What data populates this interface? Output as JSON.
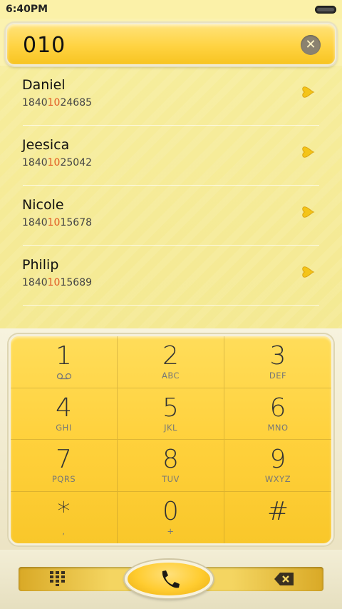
{
  "status_bar": {
    "time": "6:40PM"
  },
  "search": {
    "query": "010",
    "clear_icon": "close-icon"
  },
  "contacts": [
    {
      "name": "Daniel",
      "number_pre": "1840",
      "number_match": "10",
      "number_post": "24685"
    },
    {
      "name": "Jeesica",
      "number_pre": "1840",
      "number_match": "10",
      "number_post": "25042"
    },
    {
      "name": "Nicole",
      "number_pre": "1840",
      "number_match": "10",
      "number_post": "15678"
    },
    {
      "name": "Philip",
      "number_pre": "1840",
      "number_match": "10",
      "number_post": "15689"
    }
  ],
  "dialpad": {
    "keys": [
      {
        "digit": "1",
        "letters": ""
      },
      {
        "digit": "2",
        "letters": "ABC"
      },
      {
        "digit": "3",
        "letters": "DEF"
      },
      {
        "digit": "4",
        "letters": "GHI"
      },
      {
        "digit": "5",
        "letters": "JKL"
      },
      {
        "digit": "6",
        "letters": "MNO"
      },
      {
        "digit": "7",
        "letters": "PQRS"
      },
      {
        "digit": "8",
        "letters": "TUV"
      },
      {
        "digit": "9",
        "letters": "WXYZ"
      },
      {
        "digit": "*",
        "letters": ","
      },
      {
        "digit": "0",
        "letters": "+"
      },
      {
        "digit": "#",
        "letters": ""
      }
    ]
  },
  "colors": {
    "accent": "#ffd342",
    "match_highlight": "#e15a22",
    "background": "#f3ea9c"
  },
  "icons": {
    "contact_action": "heart-icon",
    "keypad_toggle": "keypad-grid-icon",
    "call": "phone-icon",
    "backspace": "backspace-icon",
    "voicemail": "voicemail-icon"
  }
}
